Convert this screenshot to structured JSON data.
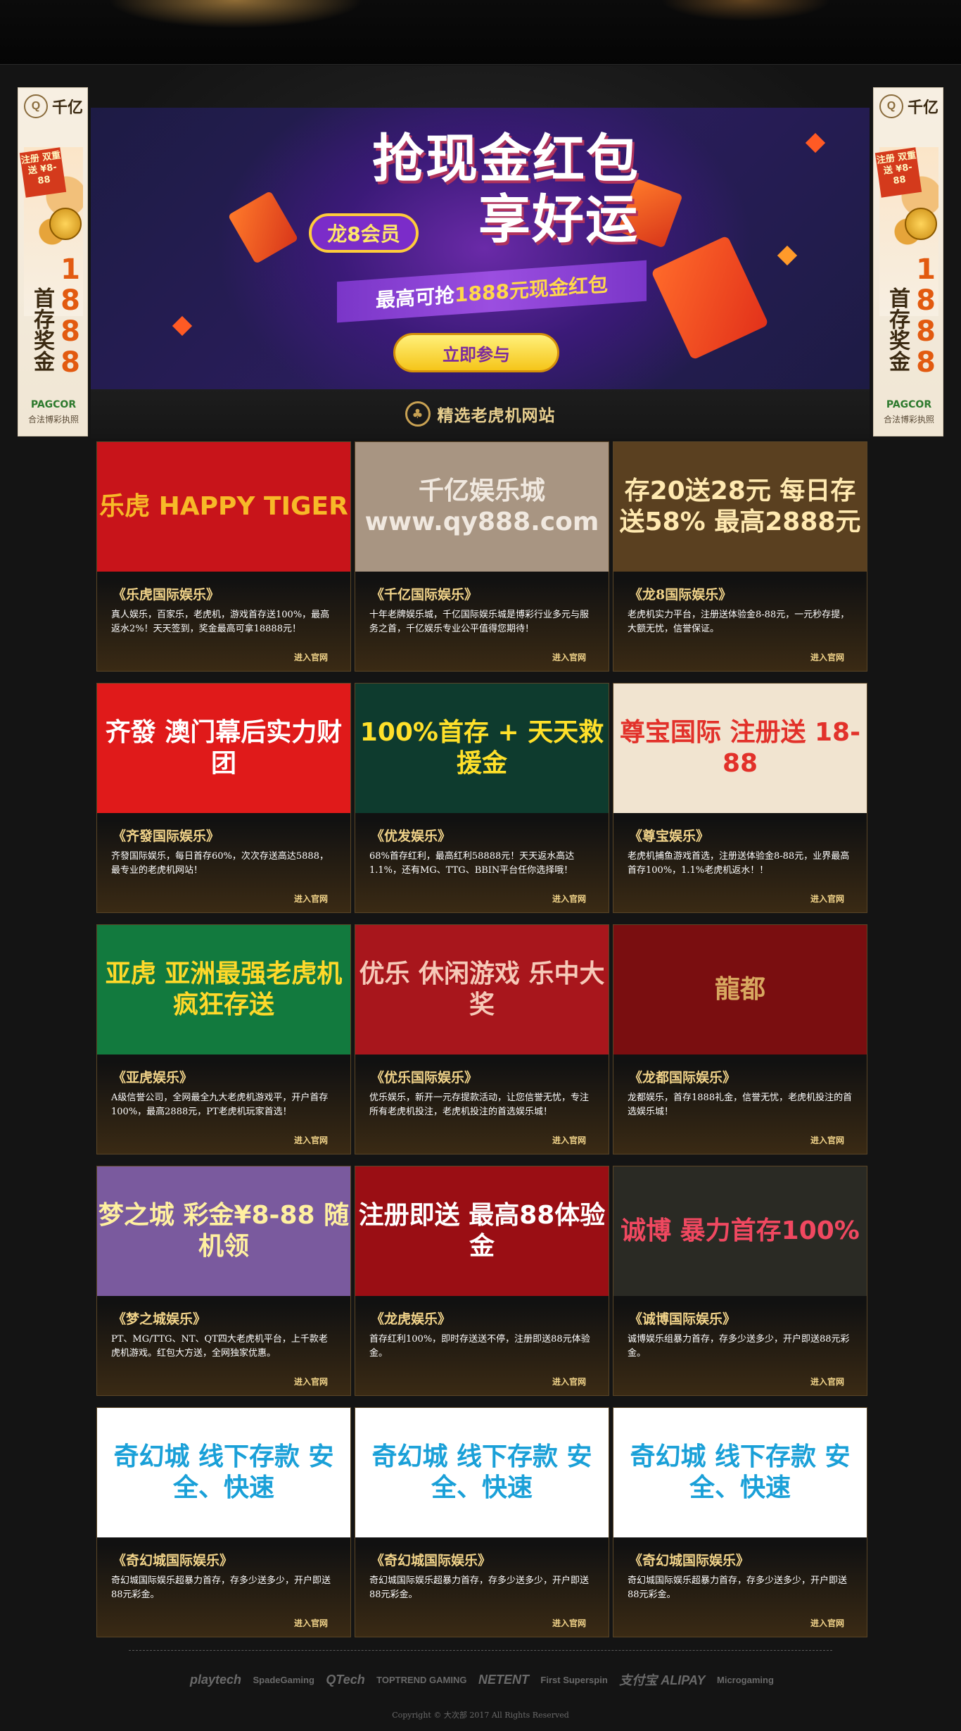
{
  "side_ad": {
    "logo_mark": "Q",
    "brand": "千亿",
    "tag": "注册 双重送 ¥8-88",
    "bonus_text": "首存奖金",
    "bonus_amount": "1888",
    "license_org": "PAGCOR",
    "license_text": "合法博彩执照"
  },
  "hero": {
    "title_line1": "抢现金红包",
    "title_line2": "享好运",
    "member_badge": "龙8会员",
    "ribbon_prefix": "最高可抢",
    "ribbon_amount": "1888元现金红包",
    "cta": "立即参与"
  },
  "section": {
    "icon": "♣",
    "heading": "精选老虎机网站"
  },
  "cards": [
    {
      "banner": "乐虎 HAPPY TIGER",
      "title": "《乐虎国际娱乐》",
      "desc": "真人娱乐，百家乐，老虎机，游戏首存送100%，最高返水2%！天天签到，奖金最高可拿18888元！",
      "link": "进入官网",
      "bg": "#c8141a",
      "fg": "#f7b928"
    },
    {
      "banner": "千亿娱乐城 www.qy888.com",
      "title": "《千亿国际娱乐》",
      "desc": "十年老牌娱乐城，千亿国际娱乐城是博彩行业多元与服务之首，千亿娱乐专业公平值得您期待！",
      "link": "进入官网",
      "bg": "#a89582",
      "fg": "#f0e8df"
    },
    {
      "banner": "存20送28元 每日存送58% 最高2888元",
      "title": "《龙8国际娱乐》",
      "desc": "老虎机实力平台，注册送体验金8-88元，一元秒存提，大额无忧，信誉保证。",
      "link": "进入官网",
      "bg": "#5a4020",
      "fg": "#ffe9b0"
    },
    {
      "banner": "齐發 澳门幕后实力财团",
      "title": "《齐發国际娱乐》",
      "desc": "齐發国际娱乐，每日首存60%，次次存送高达5888，最专业的老虎机网站！",
      "link": "进入官网",
      "bg": "#e01a1a",
      "fg": "#ffffff"
    },
    {
      "banner": "100%首存 + 天天救援金",
      "title": "《优发娱乐》",
      "desc": "68%首存红利，最高红利58888元！天天返水高达1.1%，还有MG、TTG、BBIN平台任你选择哦！",
      "link": "进入官网",
      "bg": "#0e3b2e",
      "fg": "#ffe02a"
    },
    {
      "banner": "尊宝国际 注册送 18-88",
      "title": "《尊宝娱乐》",
      "desc": "老虎机捕鱼游戏首选，注册送体验金8-88元，业界最高首存100%，1.1%老虎机返水！！",
      "link": "进入官网",
      "bg": "#f1e4d0",
      "fg": "#e2312a"
    },
    {
      "banner": "亚虎 亚洲最强老虎机 疯狂存送",
      "title": "《亚虎娱乐》",
      "desc": "A级信誉公司，全网最全九大老虎机游戏平，开户首存100%，最高2888元，PT老虎机玩家首选！",
      "link": "进入官网",
      "bg": "#127a3e",
      "fg": "#ffd92a"
    },
    {
      "banner": "优乐 休闲游戏 乐中大奖",
      "title": "《优乐国际娱乐》",
      "desc": "优乐娱乐，新开一元存提款活动，让您信誉无忧，专注所有老虎机投注，老虎机投注的首选娱乐城！",
      "link": "进入官网",
      "bg": "#a8161c",
      "fg": "#f6c9b8"
    },
    {
      "banner": "龍都",
      "title": "《龙都国际娱乐》",
      "desc": "龙都娱乐，首存1888礼金，信誉无忧，老虎机投注的首选娱乐城！",
      "link": "进入官网",
      "bg": "#7a0e10",
      "fg": "#d8a860"
    },
    {
      "banner": "梦之城 彩金¥8-88 随机领",
      "title": "《梦之城娱乐》",
      "desc": "PT、MG/TTG、NT、QT四大老虎机平台，上千款老虎机游戏。红包大方送，全网独家优惠。",
      "link": "进入官网",
      "bg": "#7a5a9e",
      "fg": "#fff0a0"
    },
    {
      "banner": "注册即送 最高88体验金",
      "title": "《龙虎娱乐》",
      "desc": "首存红利100%，即时存送送不停，注册即送88元体验金。",
      "link": "进入官网",
      "bg": "#9a0e14",
      "fg": "#ffffff"
    },
    {
      "banner": "诚博 暴力首存100%",
      "title": "《诚博国际娱乐》",
      "desc": "诚博娱乐组暴力首存，存多少送多少，开户即送88元彩金。",
      "link": "进入官网",
      "bg": "#2a2a24",
      "fg": "#f04860"
    },
    {
      "banner": "奇幻城 线下存款 安全、快速",
      "title": "《奇幻城国际娱乐》",
      "desc": "奇幻城国际娱乐超暴力首存，存多少送多少，开户即送88元彩金。",
      "link": "进入官网",
      "bg": "#ffffff",
      "fg": "#1aa0d8"
    },
    {
      "banner": "奇幻城 线下存款 安全、快速",
      "title": "《奇幻城国际娱乐》",
      "desc": "奇幻城国际娱乐超暴力首存，存多少送多少，开户即送88元彩金。",
      "link": "进入官网",
      "bg": "#ffffff",
      "fg": "#1aa0d8"
    },
    {
      "banner": "奇幻城 线下存款 安全、快速",
      "title": "《奇幻城国际娱乐》",
      "desc": "奇幻城国际娱乐超暴力首存，存多少送多少，开户即送88元彩金。",
      "link": "进入官网",
      "bg": "#ffffff",
      "fg": "#1aa0d8"
    }
  ],
  "partners": [
    "playtech",
    "SpadeGaming",
    "QTech",
    "TOPTREND GAMING",
    "NETENT",
    "First Superspin",
    "支付宝 ALIPAY",
    "Microgaming"
  ],
  "copyright": "Copyright © 大次部 2017 All Rights Reserved"
}
